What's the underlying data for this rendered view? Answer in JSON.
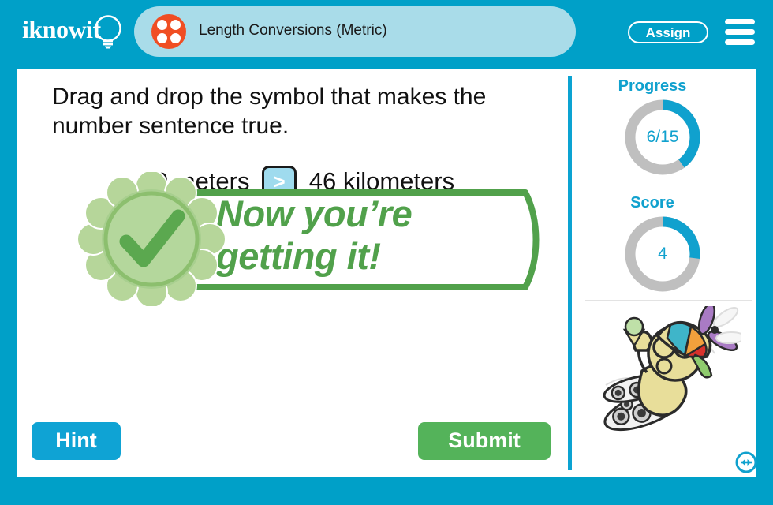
{
  "header": {
    "logo_text": "iknowit",
    "logo_icon": "lightbulb-icon",
    "title": "Length Conversions (Metric)",
    "title_icon": "four-dots-icon",
    "assign_label": "Assign",
    "menu_icon": "hamburger-menu-icon"
  },
  "question": {
    "prompt": "Drag and drop the symbol that makes the number sentence true.",
    "sentence_left": "0 meters",
    "sentence_right": "46 kilometers",
    "drop_box_symbol": ">"
  },
  "feedback": {
    "message": "Now you’re getting it!",
    "badge_icon": "green-check-badge-icon"
  },
  "buttons": {
    "hint_label": "Hint",
    "submit_label": "Submit"
  },
  "sidebar": {
    "progress_label": "Progress",
    "progress_value": "6/15",
    "progress_percent": 40,
    "score_label": "Score",
    "score_value": "4",
    "score_percent": 27,
    "mascot_icon": "bee-with-propeller-hat-icon",
    "resize_icon": "resize-horizontal-icon"
  },
  "colors": {
    "brand_blue": "#00A0C8",
    "light_blue": "#A9DCE9",
    "orange": "#F04E23",
    "green": "#54B35A",
    "feedback_green": "#51A14B",
    "hint_blue": "#0FA3D4",
    "donut_track": "#BFBFBF",
    "donut_fill": "#10A1CE"
  }
}
